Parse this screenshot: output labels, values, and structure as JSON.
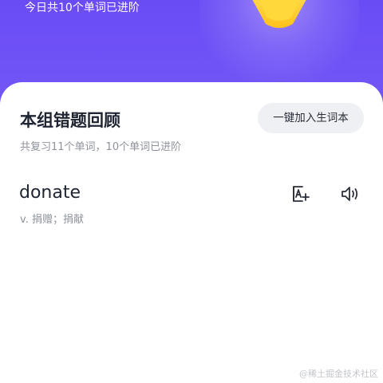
{
  "header": {
    "subtitle": "今日共10个单词已进阶",
    "trophy_icon": "gold-trophy-icon",
    "background_color": "#6a4cf5"
  },
  "review": {
    "title": "本组错题回顾",
    "add_all_button": "一键加入生词本",
    "summary": "共复习11个单词，10个单词已进阶"
  },
  "word_card": {
    "word": "donate",
    "definition": "v. 捐赠；捐献",
    "add_icon": "add-to-wordbook-icon",
    "sound_icon": "speaker-icon"
  },
  "watermark": "@稀土掘金技术社区"
}
